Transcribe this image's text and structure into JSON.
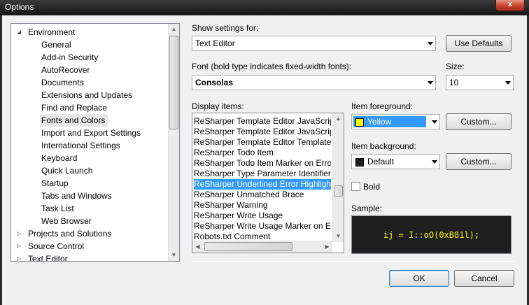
{
  "window": {
    "title": "Options",
    "close_label": "x"
  },
  "tree": {
    "items": [
      {
        "label": "Environment",
        "level": 0,
        "expanded": true
      },
      {
        "label": "General",
        "level": 1
      },
      {
        "label": "Add-in Security",
        "level": 1
      },
      {
        "label": "AutoRecover",
        "level": 1
      },
      {
        "label": "Documents",
        "level": 1
      },
      {
        "label": "Extensions and Updates",
        "level": 1
      },
      {
        "label": "Find and Replace",
        "level": 1
      },
      {
        "label": "Fonts and Colors",
        "level": 1,
        "selected": true
      },
      {
        "label": "Import and Export Settings",
        "level": 1
      },
      {
        "label": "International Settings",
        "level": 1
      },
      {
        "label": "Keyboard",
        "level": 1
      },
      {
        "label": "Quick Launch",
        "level": 1
      },
      {
        "label": "Startup",
        "level": 1
      },
      {
        "label": "Tabs and Windows",
        "level": 1
      },
      {
        "label": "Task List",
        "level": 1
      },
      {
        "label": "Web Browser",
        "level": 1
      },
      {
        "label": "Projects and Solutions",
        "level": 0,
        "expanded": false
      },
      {
        "label": "Source Control",
        "level": 0,
        "expanded": false
      },
      {
        "label": "Text Editor",
        "level": 0,
        "expanded": false
      }
    ]
  },
  "settings": {
    "show_settings_for_label": "Show settings for:",
    "show_settings_for_value": "Text Editor",
    "use_defaults_label": "Use Defaults",
    "font_label": "Font (bold type indicates fixed-width fonts):",
    "font_value": "Consolas",
    "size_label": "Size:",
    "size_value": "10"
  },
  "display_items": {
    "label": "Display items:",
    "items": [
      {
        "label": "ReSharper Template Editor JavaScript"
      },
      {
        "label": "ReSharper Template Editor JavaScript"
      },
      {
        "label": "ReSharper Template Editor Template"
      },
      {
        "label": "ReSharper Todo Item"
      },
      {
        "label": "ReSharper Todo Item Marker on Error"
      },
      {
        "label": "ReSharper Type Parameter Identifier"
      },
      {
        "label": "ReSharper Underlined Error Highlight",
        "selected": true
      },
      {
        "label": "ReSharper Unmatched Brace"
      },
      {
        "label": "ReSharper Warning"
      },
      {
        "label": "ReSharper Write Usage"
      },
      {
        "label": "ReSharper Write Usage Marker on Error"
      },
      {
        "label": "Robots.txt Comment"
      }
    ]
  },
  "colors": {
    "foreground_label": "Item foreground:",
    "foreground_value": "Yellow",
    "foreground_swatch": "#ffff00",
    "background_label": "Item background:",
    "background_value": "Default",
    "background_swatch": "#1e1e1e",
    "custom_fg_label": "Custom...",
    "custom_bg_label": "Custom...",
    "bold_label": "Bold",
    "bold_checked": false,
    "sample_label": "Sample:",
    "sample_text": "ij = I::oO(0xB81l);",
    "sample_fg": "#ffff00",
    "sample_bg": "#1e1e1e"
  },
  "footer": {
    "ok_label": "OK",
    "cancel_label": "Cancel"
  }
}
